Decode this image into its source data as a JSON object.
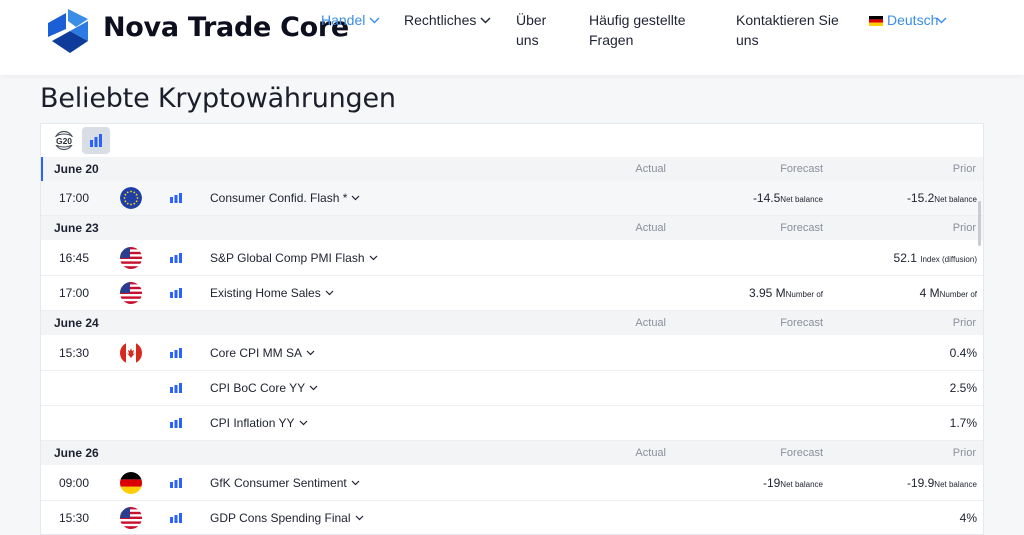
{
  "brand": {
    "name": "Nova Trade Core"
  },
  "nav": {
    "items": [
      {
        "label": "Handel"
      },
      {
        "label": "Rechtliches"
      },
      {
        "label": "Über uns"
      },
      {
        "label": "Häufig gestellte Fragen"
      },
      {
        "label": "Kontaktieren Sie uns"
      },
      {
        "label": "Deutsch"
      }
    ],
    "active_color": "#3a8ee6"
  },
  "page": {
    "title": "Beliebte Kryptowährungen"
  },
  "toolbar": {
    "g20_label": "G20"
  },
  "columns": {
    "actual": "Actual",
    "forecast": "Forecast",
    "prior": "Prior"
  },
  "groups": [
    {
      "date": "June 20",
      "events": [
        {
          "time": "17:00",
          "country": "EU",
          "name": "Consumer Confid. Flash *",
          "forecast": "-14.5",
          "forecast_unit": "Net balance",
          "prior": "-15.2",
          "prior_unit": "Net balance"
        }
      ]
    },
    {
      "date": "June 23",
      "events": [
        {
          "time": "16:45",
          "country": "US",
          "name": "S&P Global Comp PMI Flash",
          "forecast": "",
          "forecast_unit": "",
          "prior": "52.1",
          "prior_unit": "Index (diffusion)"
        },
        {
          "time": "17:00",
          "country": "US",
          "name": "Existing Home Sales",
          "forecast": "3.95 M",
          "forecast_unit": "Number of",
          "prior": "4 M",
          "prior_unit": "Number of"
        }
      ]
    },
    {
      "date": "June 24",
      "events": [
        {
          "time": "15:30",
          "country": "CA",
          "name": "Core CPI MM SA",
          "forecast": "",
          "forecast_unit": "",
          "prior": "0.4%",
          "prior_unit": ""
        },
        {
          "time": "",
          "country": "",
          "name": "CPI BoC Core YY",
          "forecast": "",
          "forecast_unit": "",
          "prior": "2.5%",
          "prior_unit": ""
        },
        {
          "time": "",
          "country": "",
          "name": "CPI Inflation YY",
          "forecast": "",
          "forecast_unit": "",
          "prior": "1.7%",
          "prior_unit": ""
        }
      ]
    },
    {
      "date": "June 26",
      "events": [
        {
          "time": "09:00",
          "country": "DE",
          "name": "GfK Consumer Sentiment",
          "forecast": "-19",
          "forecast_unit": "Net balance",
          "prior": "-19.9",
          "prior_unit": "Net balance"
        },
        {
          "time": "15:30",
          "country": "US",
          "name": "GDP Cons Spending Final",
          "forecast": "",
          "forecast_unit": "",
          "prior": "4%",
          "prior_unit": ""
        }
      ]
    }
  ]
}
